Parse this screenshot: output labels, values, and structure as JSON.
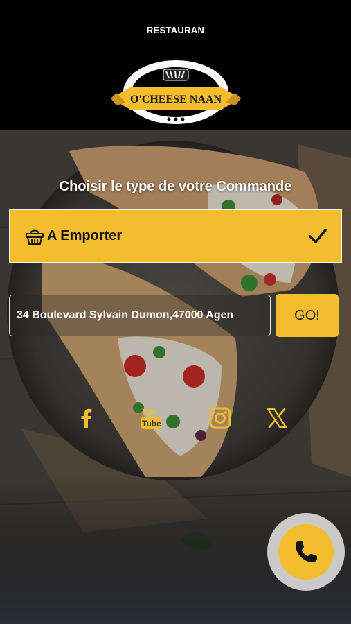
{
  "header": {
    "title": "RESTAURAN",
    "logo_text": "O'CHEESE NAAN"
  },
  "order": {
    "heading": "Choisir le type de votre Commande",
    "selected_type_label": "A Emporter",
    "address_value": "34 Boulevard Sylvain Dumon,47000 Agen",
    "go_label": "GO!"
  },
  "social": [
    "facebook-icon",
    "youtube-icon",
    "instagram-icon",
    "x-icon"
  ],
  "colors": {
    "accent": "#f3bd2e",
    "header_bg": "#000000"
  }
}
